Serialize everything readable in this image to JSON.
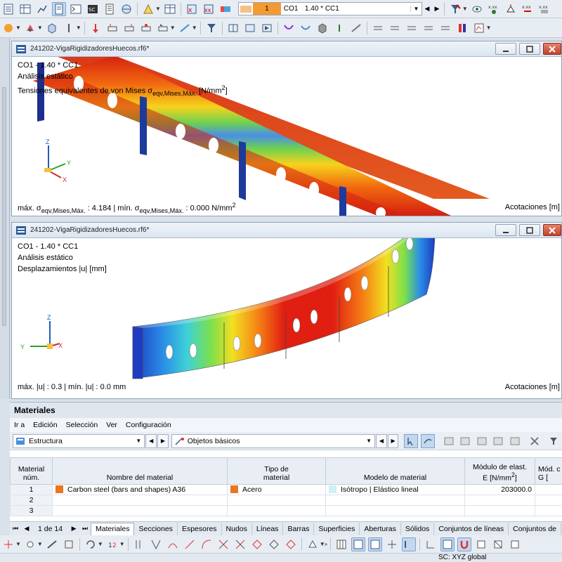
{
  "toolbar": {
    "load_case": {
      "number": "1",
      "code": "CO1",
      "name": "1.40 * CC1"
    }
  },
  "window_top": {
    "title": "241202-VigaRigidizadoresHuecos.rf6*",
    "lines": [
      "CO1 - 1.40 * CC1",
      "Análisis estático"
    ],
    "result_label": "Tensiones equivalentes de von Mises",
    "result_symbol": "σ",
    "result_subscript": "eqv,Mises,Máx.",
    "result_unit": "[N/mm",
    "result_unit_sup": "2",
    "result_unit_end": "]",
    "footer_max_prefix": "máx. σ",
    "footer_max_sub": "eqv,Mises,Máx.",
    "footer_max_value": " : 4.184 | mín. σ",
    "footer_min_sub": "eqv,Mises,Máx.",
    "footer_min_value": " : 0.000 N/mm",
    "footer_unit_sup": "2",
    "footer_right": "Acotaciones [m]",
    "axes": {
      "z": "Z",
      "y": "Y",
      "x": "X"
    }
  },
  "window_bottom": {
    "title": "241202-VigaRigidizadoresHuecos.rf6*",
    "lines": [
      "CO1 - 1.40 * CC1",
      "Análisis estático",
      "Desplazamientos |u| [mm]"
    ],
    "footer_left": "máx. |u| : 0.3 | mín. |u| : 0.0 mm",
    "footer_right": "Acotaciones [m]",
    "axes": {
      "z": "Z",
      "y": "Y",
      "x": "X"
    }
  },
  "materials": {
    "title": "Materiales",
    "menu": [
      "Ir a",
      "Edición",
      "Selección",
      "Ver",
      "Configuración"
    ],
    "combo_left": "Estructura",
    "combo_right": "Objetos básicos",
    "headers": {
      "num_1": "Material",
      "num_2": "núm.",
      "name": "Nombre del material",
      "type_1": "Tipo de",
      "type_2": "material",
      "model": "Modelo de material",
      "e_1": "Módulo de elast.",
      "e_2": "E [N/mm",
      "e_sup": "2",
      "e_end": "]",
      "g_1": "Mód. c",
      "g_2": "G ["
    },
    "rows": [
      {
        "num": "1",
        "name": "Carbon steel (bars and shapes) A36",
        "name_color": "#e87722",
        "type": "Acero",
        "type_color": "#e87722",
        "model": "Isótropo | Elástico lineal",
        "model_color": "#cdf1f4",
        "e": "203000.0",
        "g": ""
      },
      {
        "num": "2",
        "name": "",
        "type": "",
        "model": "",
        "e": "",
        "g": ""
      },
      {
        "num": "3",
        "name": "",
        "type": "",
        "model": "",
        "e": "",
        "g": ""
      }
    ]
  },
  "tabs": {
    "page": "1 de 14",
    "items": [
      "Materiales",
      "Secciones",
      "Espesores",
      "Nudos",
      "Líneas",
      "Barras",
      "Superficies",
      "Aberturas",
      "Sólidos",
      "Conjuntos de líneas",
      "Conjuntos de"
    ]
  },
  "status": {
    "cs": "SC: XYZ global"
  }
}
